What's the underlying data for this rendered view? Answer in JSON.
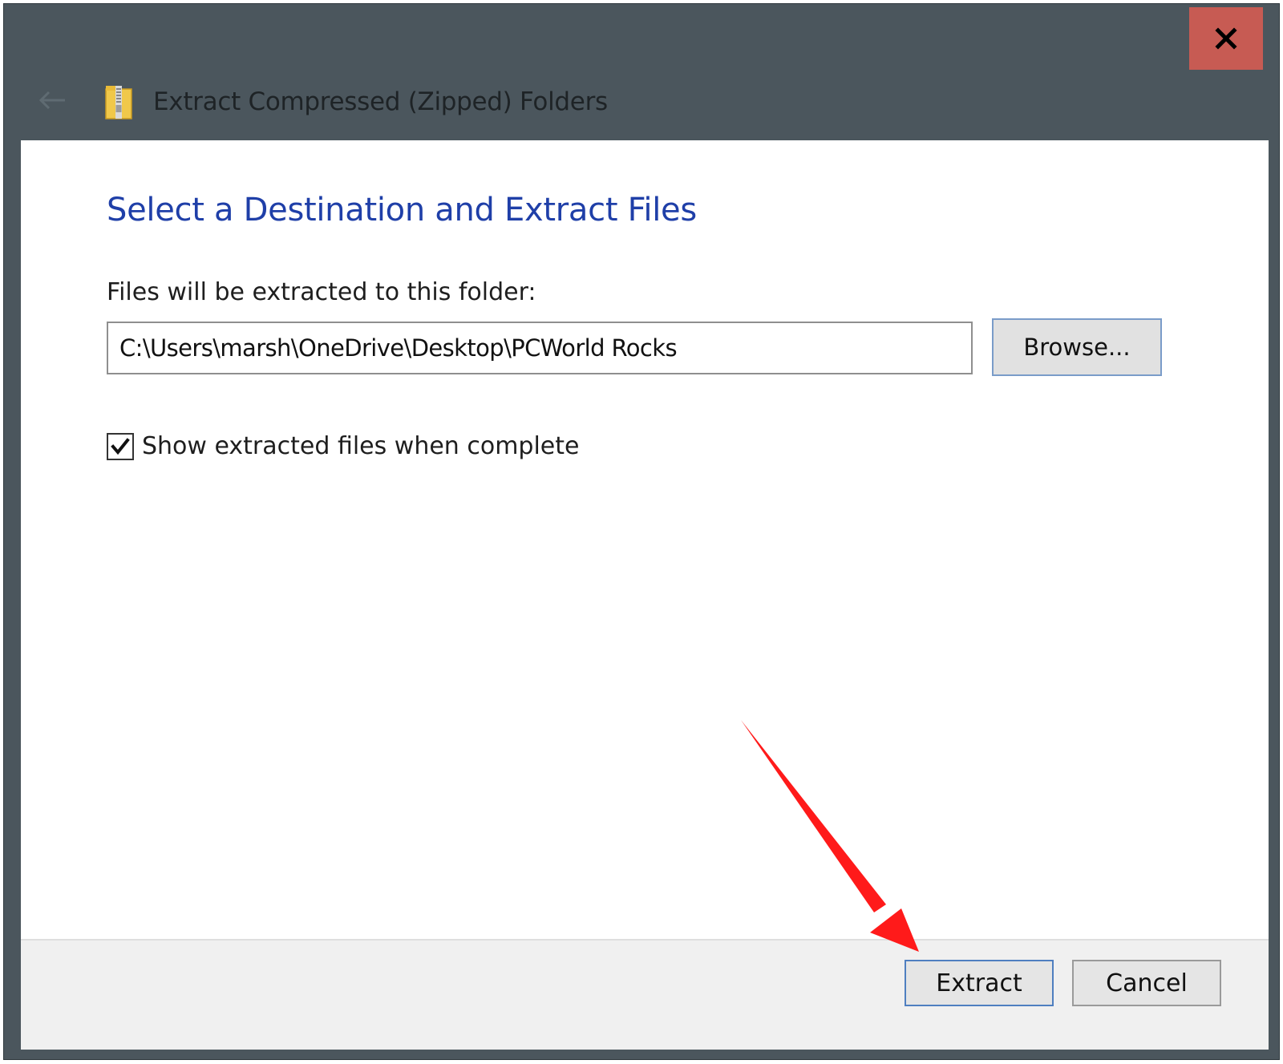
{
  "window": {
    "title": "Extract Compressed (Zipped) Folders",
    "close_glyph": "x",
    "back_glyph": "←",
    "icons": {
      "close": "close-icon",
      "back": "back-arrow-icon",
      "app": "zip-folder-icon"
    },
    "colors": {
      "titlebar": "#4b565d",
      "close_button": "#c75b53",
      "heading": "#1f3fa8"
    }
  },
  "dialog": {
    "heading": "Select a Destination and Extract Files",
    "destination_label": "Files will be extracted to this folder:",
    "destination_path": "C:\\Users\\marsh\\OneDrive\\Desktop\\PCWorld Rocks",
    "browse_label": "Browse...",
    "show_files_label": "Show extracted files when complete",
    "show_files_checked": true
  },
  "footer": {
    "extract_label": "Extract",
    "cancel_label": "Cancel"
  },
  "annotation": {
    "type": "red arrow",
    "points_to": "Extract button",
    "color": "#ff1a1a"
  }
}
